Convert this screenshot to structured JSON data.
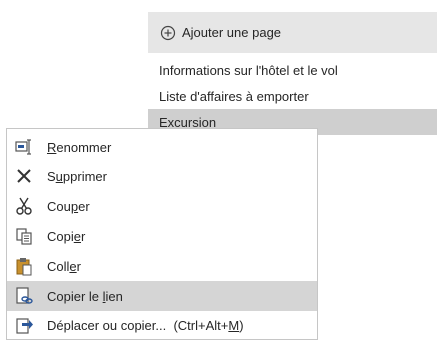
{
  "pages_panel": {
    "add_page_label": "Ajouter une page",
    "pages": [
      "Informations sur l'hôtel et le vol",
      "Liste d'affaires à emporter",
      "Excursion"
    ]
  },
  "context_menu": {
    "items": [
      {
        "pre": "",
        "u": "R",
        "post": "enommer",
        "icon": "rename-icon"
      },
      {
        "pre": "S",
        "u": "u",
        "post": "pprimer",
        "icon": "delete-x-icon"
      },
      {
        "pre": "Cou",
        "u": "p",
        "post": "er",
        "icon": "scissors-icon"
      },
      {
        "pre": "Copi",
        "u": "e",
        "post": "r",
        "icon": "copy-icon"
      },
      {
        "pre": "Coll",
        "u": "e",
        "post": "r",
        "icon": "paste-icon"
      },
      {
        "pre": "Copier le ",
        "u": "l",
        "post": "ien",
        "icon": "link-icon"
      },
      {
        "pre": "Déplacer ou copier...  (Ctrl+Alt+",
        "u": "M",
        "post": ")",
        "icon": "move-copy-icon"
      }
    ]
  },
  "colors": {
    "header_bg": "#e6e6e6",
    "selected_bg": "#cfcfcf",
    "hover_bg": "#d5d5d5",
    "accent_blue": "#2b579a"
  }
}
